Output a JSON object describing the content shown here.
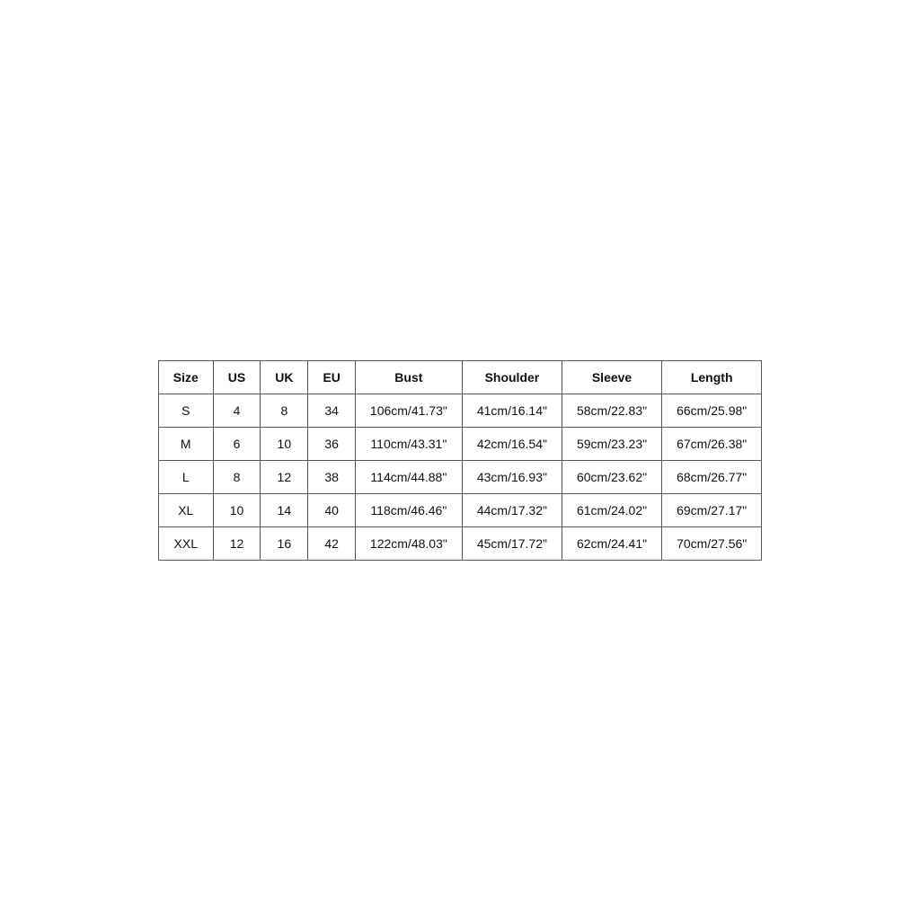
{
  "table": {
    "headers": [
      "Size",
      "US",
      "UK",
      "EU",
      "Bust",
      "Shoulder",
      "Sleeve",
      "Length"
    ],
    "rows": [
      {
        "size": "S",
        "us": "4",
        "uk": "8",
        "eu": "34",
        "bust": "106cm/41.73\"",
        "shoulder": "41cm/16.14\"",
        "sleeve": "58cm/22.83\"",
        "length": "66cm/25.98\""
      },
      {
        "size": "M",
        "us": "6",
        "uk": "10",
        "eu": "36",
        "bust": "110cm/43.31\"",
        "shoulder": "42cm/16.54\"",
        "sleeve": "59cm/23.23\"",
        "length": "67cm/26.38\""
      },
      {
        "size": "L",
        "us": "8",
        "uk": "12",
        "eu": "38",
        "bust": "114cm/44.88\"",
        "shoulder": "43cm/16.93\"",
        "sleeve": "60cm/23.62\"",
        "length": "68cm/26.77\""
      },
      {
        "size": "XL",
        "us": "10",
        "uk": "14",
        "eu": "40",
        "bust": "118cm/46.46\"",
        "shoulder": "44cm/17.32\"",
        "sleeve": "61cm/24.02\"",
        "length": "69cm/27.17\""
      },
      {
        "size": "XXL",
        "us": "12",
        "uk": "16",
        "eu": "42",
        "bust": "122cm/48.03\"",
        "shoulder": "45cm/17.72\"",
        "sleeve": "62cm/24.41\"",
        "length": "70cm/27.56\""
      }
    ]
  }
}
